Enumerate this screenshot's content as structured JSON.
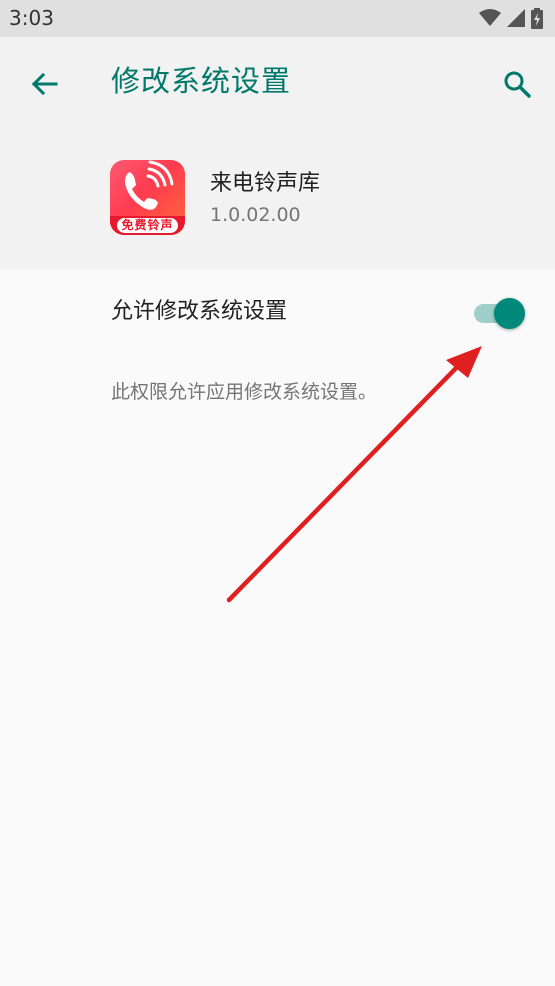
{
  "status_bar": {
    "time": "3:03"
  },
  "toolbar": {
    "title": "修改系统设置"
  },
  "app": {
    "name": "来电铃声库",
    "version": "1.0.02.00",
    "icon_badge": "免费铃声"
  },
  "setting": {
    "label": "允许修改系统设置",
    "enabled": true,
    "description": "此权限允许应用修改系统设置。"
  },
  "colors": {
    "accent": "#00796b",
    "toggle_thumb": "#00897b",
    "toggle_track": "#9fcfca",
    "annotation_arrow": "#e02020"
  }
}
